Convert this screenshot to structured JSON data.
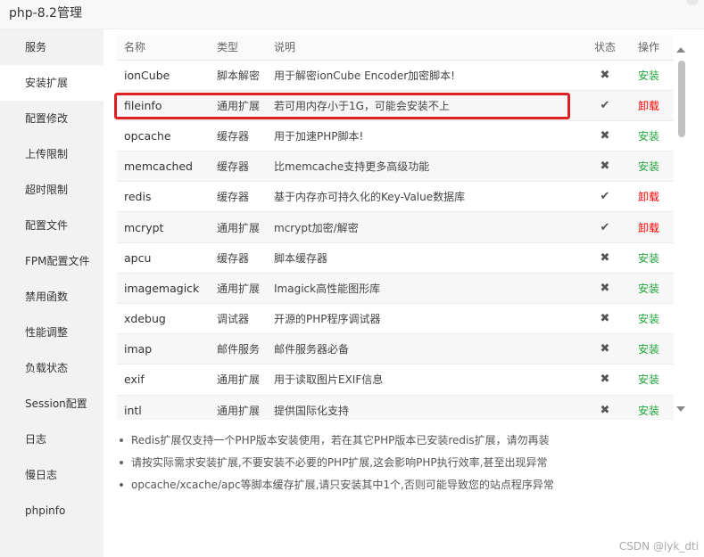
{
  "window": {
    "title": "php-8.2管理"
  },
  "sidebar": {
    "items": [
      {
        "label": "服务"
      },
      {
        "label": "安装扩展",
        "active": true
      },
      {
        "label": "配置修改"
      },
      {
        "label": "上传限制"
      },
      {
        "label": "超时限制"
      },
      {
        "label": "配置文件"
      },
      {
        "label": "FPM配置文件"
      },
      {
        "label": "禁用函数"
      },
      {
        "label": "性能调整"
      },
      {
        "label": "负载状态"
      },
      {
        "label": "Session配置"
      },
      {
        "label": "日志"
      },
      {
        "label": "慢日志"
      },
      {
        "label": "phpinfo"
      }
    ]
  },
  "table": {
    "headers": {
      "name": "名称",
      "type": "类型",
      "desc": "说明",
      "status": "状态",
      "op": "操作"
    },
    "rows": [
      {
        "name": "ionCube",
        "type": "脚本解密",
        "desc": "用于解密ionCube Encoder加密脚本!",
        "status": "✖",
        "op": "安装"
      },
      {
        "name": "fileinfo",
        "type": "通用扩展",
        "desc": "若可用内存小于1G，可能会安装不上",
        "status": "✔",
        "op": "卸载"
      },
      {
        "name": "opcache",
        "type": "缓存器",
        "desc": "用于加速PHP脚本!",
        "status": "✖",
        "op": "安装"
      },
      {
        "name": "memcached",
        "type": "缓存器",
        "desc": "比memcache支持更多高级功能",
        "status": "✖",
        "op": "安装"
      },
      {
        "name": "redis",
        "type": "缓存器",
        "desc": "基于内存亦可持久化的Key-Value数据库",
        "status": "✔",
        "op": "卸载"
      },
      {
        "name": "mcrypt",
        "type": "通用扩展",
        "desc": "mcrypt加密/解密",
        "status": "✔",
        "op": "卸载"
      },
      {
        "name": "apcu",
        "type": "缓存器",
        "desc": "脚本缓存器",
        "status": "✖",
        "op": "安装"
      },
      {
        "name": "imagemagick",
        "type": "通用扩展",
        "desc": "Imagick高性能图形库",
        "status": "✖",
        "op": "安装"
      },
      {
        "name": "xdebug",
        "type": "调试器",
        "desc": "开源的PHP程序调试器",
        "status": "✖",
        "op": "安装"
      },
      {
        "name": "imap",
        "type": "邮件服务",
        "desc": "邮件服务器必备",
        "status": "✖",
        "op": "安装"
      },
      {
        "name": "exif",
        "type": "通用扩展",
        "desc": "用于读取图片EXIF信息",
        "status": "✖",
        "op": "安装"
      },
      {
        "name": "intl",
        "type": "通用扩展",
        "desc": "提供国际化支持",
        "status": "✖",
        "op": "安装"
      }
    ]
  },
  "tips": [
    "Redis扩展仅支持一个PHP版本安装使用，若在其它PHP版本已安装redis扩展，请勿再装",
    "请按实际需求安装扩展,不要安装不必要的PHP扩展,这会影响PHP执行效率,甚至出现异常",
    "opcache/xcache/apc等脚本缓存扩展,请只安装其中1个,否则可能导致您的站点程序异常"
  ],
  "watermark": "CSDN @lyk_dti",
  "colors": {
    "install": "#20a53a",
    "uninstall": "#ff0000",
    "highlight": "#e02020"
  }
}
